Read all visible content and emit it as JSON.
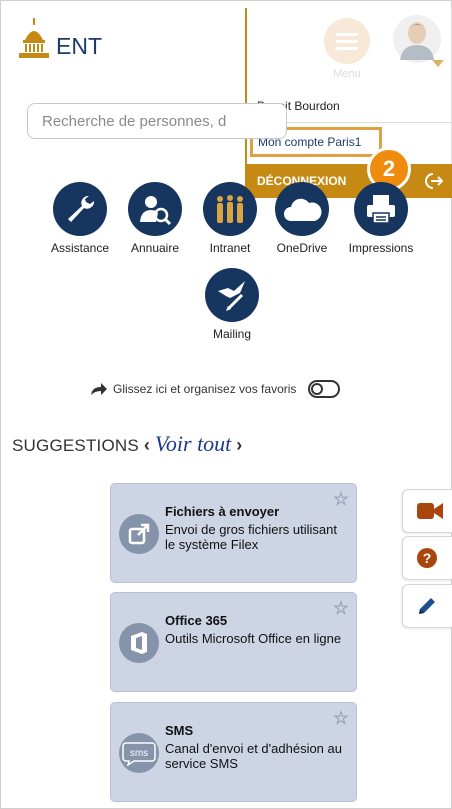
{
  "header": {
    "logo_text": "ENT",
    "menu_label": "Menu"
  },
  "user_menu": {
    "user_name": "Benoit Bourdon",
    "account_link": "Mon compte Paris1",
    "logout_label": "DÉCONNEXION",
    "step_number": "2"
  },
  "search": {
    "placeholder": "Recherche de personnes, d"
  },
  "apps": [
    {
      "label": "Assistance",
      "icon": "wrench-icon"
    },
    {
      "label": "Annuaire",
      "icon": "person-search-icon"
    },
    {
      "label": "Intranet",
      "icon": "people-icon"
    },
    {
      "label": "OneDrive",
      "icon": "cloud-icon"
    },
    {
      "label": "Impressions",
      "icon": "printer-icon"
    },
    {
      "label": "Mailing",
      "icon": "bird-pen-icon"
    }
  ],
  "favorites": {
    "hint": "Glissez ici et organisez vos favoris"
  },
  "suggestions": {
    "title": "SUGGESTIONS",
    "see_all": "Voir tout",
    "cards": [
      {
        "title": "Fichiers à envoyer",
        "description": "Envoi de gros fichiers utilisant le système Filex",
        "icon": "external-link-icon"
      },
      {
        "title": "Office 365",
        "description": "Outils Microsoft Office en ligne",
        "icon": "office-icon"
      },
      {
        "title": "SMS",
        "description": "Canal d'envoi et d'adhésion au service SMS",
        "icon": "sms-icon",
        "icon_text": "sms"
      }
    ]
  },
  "side_actions": [
    {
      "icon": "video-camera-icon"
    },
    {
      "icon": "help-icon"
    },
    {
      "icon": "pencil-icon"
    }
  ],
  "colors": {
    "brand_navy": "#17365f",
    "accent_gold": "#c68a14",
    "badge_orange": "#ef8c0d",
    "card_bg": "#cdd4e4",
    "link_blue": "#1d3b8e"
  }
}
